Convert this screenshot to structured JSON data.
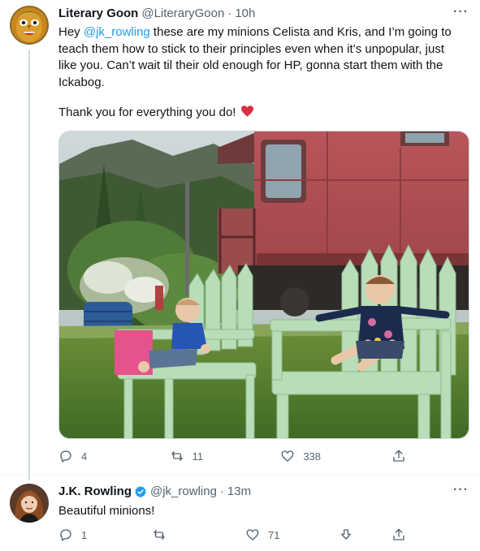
{
  "tweet1": {
    "display_name": "Literary Goon",
    "handle": "@LiteraryGoon",
    "separator": "·",
    "time": "10h",
    "text_mention": "@jk_rowling",
    "text_before_mention": "Hey ",
    "text_after_mention": " these are my minions Celista and Kris, and I’m going to teach them how to stick to their principles even when it’s unpopular, just like you. Can’t wait til their old enough for HP, gonna start them with the Ickabog.",
    "text_second_paragraph": "Thank you for everything you do!",
    "actions": {
      "replies": "4",
      "retweets": "11",
      "likes": "338"
    }
  },
  "tweet2": {
    "display_name": "J.K. Rowling",
    "handle": "@jk_rowling",
    "separator": "·",
    "time": "13m",
    "text": "Beautiful minions!",
    "actions": {
      "replies": "1",
      "retweets": "",
      "likes": "71"
    }
  },
  "colors": {
    "accent": "#1d9bf0",
    "text_secondary": "#536471",
    "heart": "#f91880",
    "verified": "#1d9bf0"
  }
}
